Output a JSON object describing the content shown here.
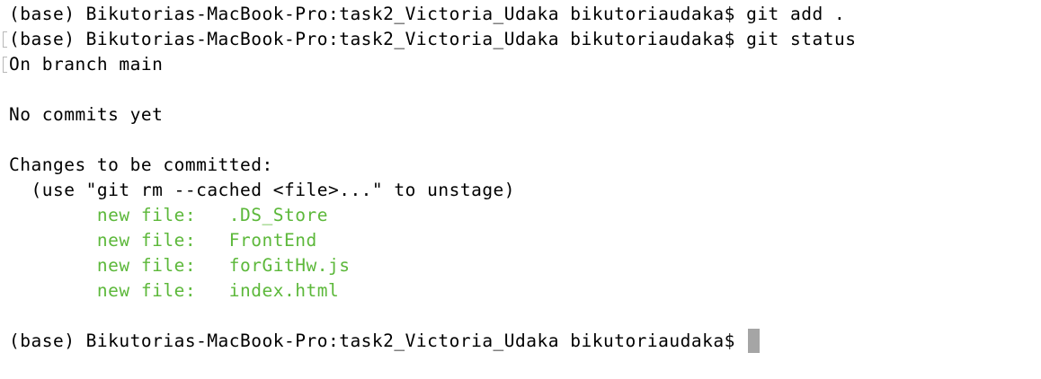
{
  "terminal": {
    "lines": {
      "cmd_add": "(base) Bikutorias-MacBook-Pro:task2_Victoria_Udaka bikutoriaudaka$ git add .",
      "cmd_status": "(base) Bikutorias-MacBook-Pro:task2_Victoria_Udaka bikutoriaudaka$ git status",
      "branch": "On branch main",
      "no_commits": "No commits yet",
      "changes_header": "Changes to be committed:",
      "hint": "  (use \"git rm --cached <file>...\" to unstage)",
      "staged": [
        "\tnew file:   .DS_Store",
        "\tnew file:   FrontEnd",
        "\tnew file:   forGitHw.js",
        "\tnew file:   index.html"
      ],
      "prompt": "(base) Bikutorias-MacBook-Pro:task2_Victoria_Udaka bikutoriaudaka$ "
    },
    "colors": {
      "background": "#ffffff",
      "text": "#000000",
      "staged_file": "#5cb83a",
      "cursor": "#a5a5a5"
    }
  }
}
